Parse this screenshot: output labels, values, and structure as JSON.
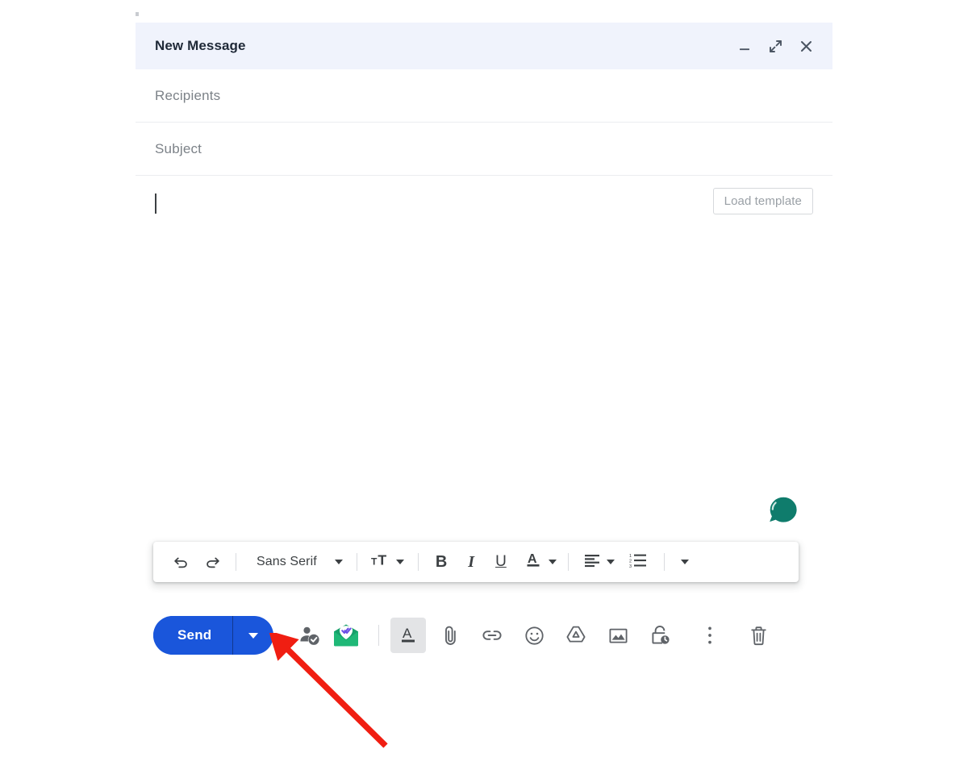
{
  "window": {
    "title": "New Message",
    "header_buttons": [
      {
        "name": "minimize",
        "label": "Minimize"
      },
      {
        "name": "expand",
        "label": "Full screen"
      },
      {
        "name": "close",
        "label": "Save & close"
      }
    ]
  },
  "fields": {
    "recipients_placeholder": "Recipients",
    "subject_placeholder": "Subject"
  },
  "body": {
    "content": "",
    "load_template_label": "Load template"
  },
  "chat_fab": {
    "icon": "chat-bubble-icon"
  },
  "formatting_toolbar": {
    "undo_label": "Undo",
    "redo_label": "Redo",
    "font_name": "Sans Serif",
    "size_label": "Size",
    "bold_label": "B",
    "italic_label": "I",
    "underline_label": "U",
    "text_color_label": "A",
    "align_label": "Align",
    "numbered_list_label": "Numbered list",
    "more_label": "More formatting options"
  },
  "action_bar": {
    "send_label": "Send",
    "send_options_label": "More send options",
    "icons": [
      {
        "name": "contact-verified-icon",
        "label": "Verified contact"
      },
      {
        "name": "mail-tracking-icon",
        "label": "Mail tracking"
      },
      {
        "name": "formatting-options-icon",
        "label": "Formatting options"
      },
      {
        "name": "attach-file-icon",
        "label": "Attach files"
      },
      {
        "name": "insert-link-icon",
        "label": "Insert link"
      },
      {
        "name": "insert-emoji-icon",
        "label": "Insert emoji"
      },
      {
        "name": "insert-drive-icon",
        "label": "Insert files using Drive"
      },
      {
        "name": "insert-photo-icon",
        "label": "Insert photo"
      },
      {
        "name": "confidential-mode-icon",
        "label": "Toggle confidential mode"
      },
      {
        "name": "more-options-icon",
        "label": "More options"
      },
      {
        "name": "discard-draft-icon",
        "label": "Discard draft"
      }
    ]
  },
  "colors": {
    "header_bg": "#F0F3FC",
    "send_blue": "#1A56DB",
    "chat_teal": "#0F7C6C",
    "annotation_red": "#F01E12",
    "placeholder_gray": "#7C8288"
  }
}
